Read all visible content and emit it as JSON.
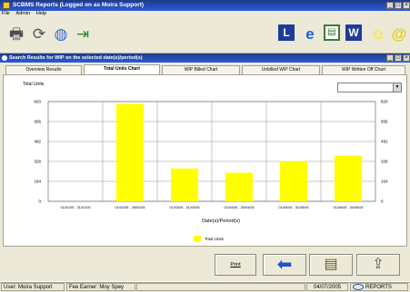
{
  "window": {
    "title": "SCBMS Reports  (Logged on as Moira Support)",
    "controls": [
      "_",
      "□",
      "×"
    ]
  },
  "menu": [
    "File",
    "Admin",
    "Help"
  ],
  "toolbar": {
    "left_icons": [
      "printer-icon",
      "refresh-icon",
      "globe-icon",
      "exit-icon"
    ],
    "right_icons": [
      "l-icon",
      "ie-icon",
      "doc-icon",
      "w-icon",
      "smiley-icon",
      "at-icon"
    ]
  },
  "inner_window": {
    "title": "Search Results for WIP on the selected date(s)/period(s)",
    "controls": [
      "_",
      "□",
      "×"
    ]
  },
  "tabs": [
    {
      "label": "Overview Results",
      "active": false
    },
    {
      "label": "Total Units Chart",
      "active": true
    },
    {
      "label": "WIP Billed Chart",
      "active": false
    },
    {
      "label": "Unbilled WIP Chart",
      "active": false
    },
    {
      "label": "WIP Written Off Chart",
      "active": false
    }
  ],
  "dropdown": {
    "value": ""
  },
  "chart_data": {
    "type": "bar",
    "title": "Total Units",
    "xlabel": "Date(s)/Period(s)",
    "ylabel": "",
    "ylim": [
      0,
      820
    ],
    "yticks": [
      0,
      164,
      328,
      492,
      656,
      820
    ],
    "categories": [
      "01/01/05 - 31/01/05",
      "01/02/05 - 28/02/05",
      "01/03/05 - 31/03/05",
      "01/04/05 - 30/04/05",
      "01/05/05 - 31/05/05",
      "01/06/05 - 30/06/05"
    ],
    "series": [
      {
        "name": "Total Units",
        "color": "#ffff00",
        "values": [
          0,
          800,
          270,
          235,
          330,
          375
        ]
      }
    ],
    "legend": "bottom",
    "grid": true
  },
  "buttons": {
    "print_label": "Print",
    "back_icon": "back-arrow-icon",
    "report_icon": "report-icon",
    "export_icon": "export-icon"
  },
  "status": {
    "user": "User: Moira Support",
    "fee_earner": "Fee Earner: Moy Spey",
    "date": "04/07/2005",
    "app": "REPORTS"
  }
}
